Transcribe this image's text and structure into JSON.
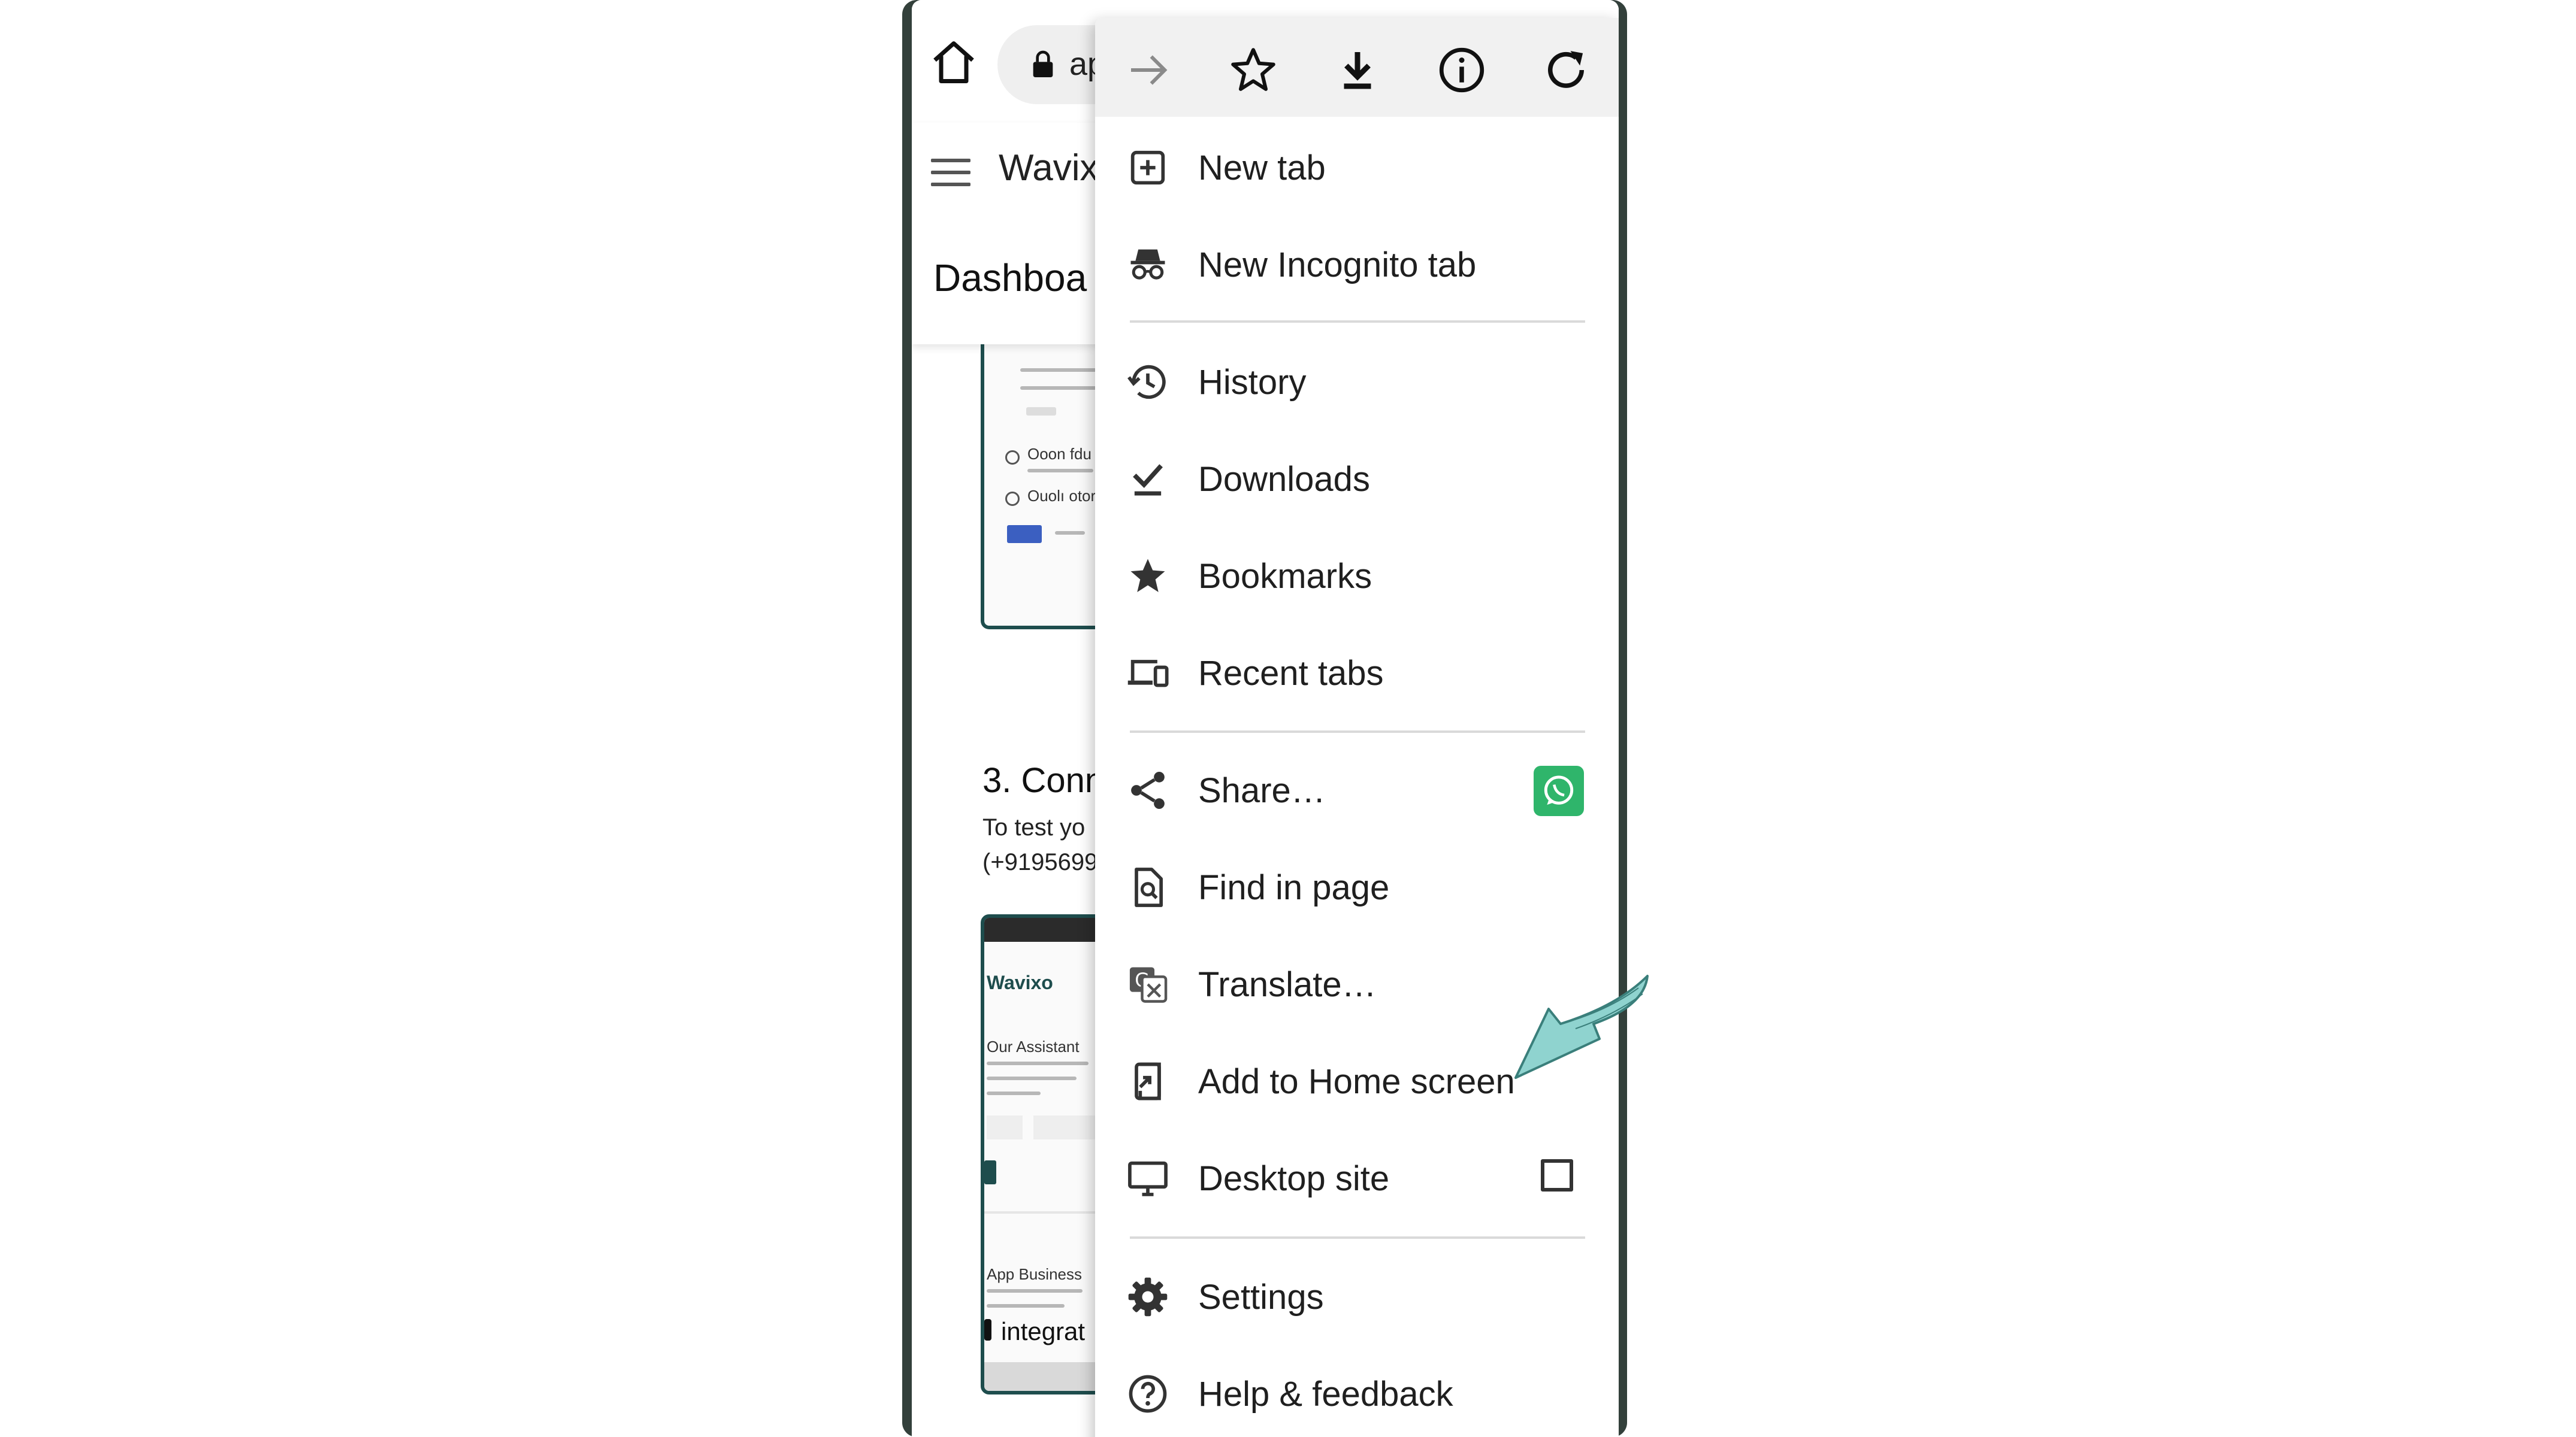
{
  "browser": {
    "url_fragment": "ap"
  },
  "page": {
    "site_name": "Wavix",
    "title": "Dashboa",
    "section_heading": "3. Conn",
    "section_text_line1": "To test yo",
    "section_text_line2": "(+9195699",
    "thumb1_texts": [
      "Ooon fdu ı",
      "Ouolı otoro"
    ],
    "thumb2_texts": [
      "Wavixo",
      "Our Assistant",
      "App Business",
      "integrat"
    ]
  },
  "menu": {
    "top_icons": [
      "forward-icon",
      "star-icon",
      "download-icon",
      "info-icon",
      "reload-icon"
    ],
    "items": [
      {
        "label": "New tab",
        "icon": "new-tab-icon"
      },
      {
        "label": "New Incognito tab",
        "icon": "incognito-icon"
      },
      {
        "label": "History",
        "icon": "history-icon"
      },
      {
        "label": "Downloads",
        "icon": "downloads-icon"
      },
      {
        "label": "Bookmarks",
        "icon": "bookmarks-icon"
      },
      {
        "label": "Recent tabs",
        "icon": "recent-tabs-icon"
      },
      {
        "label": "Share…",
        "icon": "share-icon"
      },
      {
        "label": "Find in page",
        "icon": "find-in-page-icon"
      },
      {
        "label": "Translate…",
        "icon": "translate-icon"
      },
      {
        "label": "Add to Home screen",
        "icon": "add-to-home-screen-icon"
      },
      {
        "label": "Desktop site",
        "icon": "desktop-site-icon"
      },
      {
        "label": "Settings",
        "icon": "settings-icon"
      },
      {
        "label": "Help & feedback",
        "icon": "help-icon"
      }
    ],
    "desktop_site_checked": false
  },
  "colors": {
    "frame": "#33403b",
    "accent_teal": "#1e4d4d",
    "whatsapp_green": "#2fb56b",
    "annotation_arrow": "#8fd3cf"
  }
}
